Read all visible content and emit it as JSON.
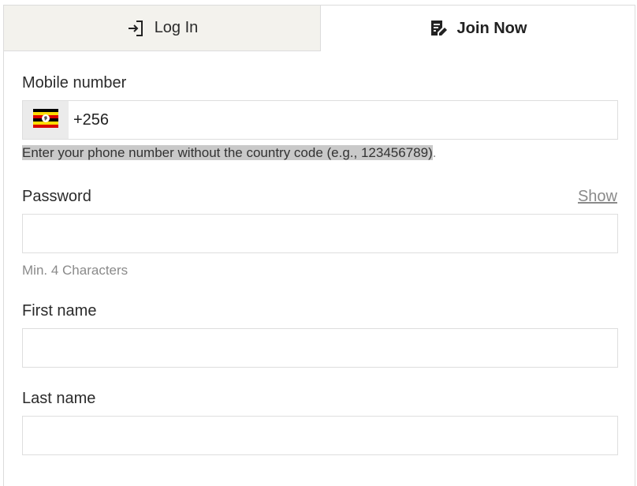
{
  "tabs": {
    "login_label": "Log In",
    "join_label": "Join Now",
    "active": "join"
  },
  "form": {
    "mobile": {
      "label": "Mobile number",
      "country_flag": "uganda-flag-icon",
      "value": "+256",
      "hint": "Enter your phone number without the country code (e.g., 123456789)",
      "hint_end": "."
    },
    "password": {
      "label": "Password",
      "show_label": "Show",
      "value": "",
      "hint": "Min. 4 Characters"
    },
    "first_name": {
      "label": "First name",
      "value": ""
    },
    "last_name": {
      "label": "Last name",
      "value": ""
    }
  },
  "colors": {
    "inactive_tab_bg": "#f3f2ed",
    "border": "#dedede",
    "hint_text": "#8a8a8a",
    "hint_highlight": "#c9c9c9"
  }
}
